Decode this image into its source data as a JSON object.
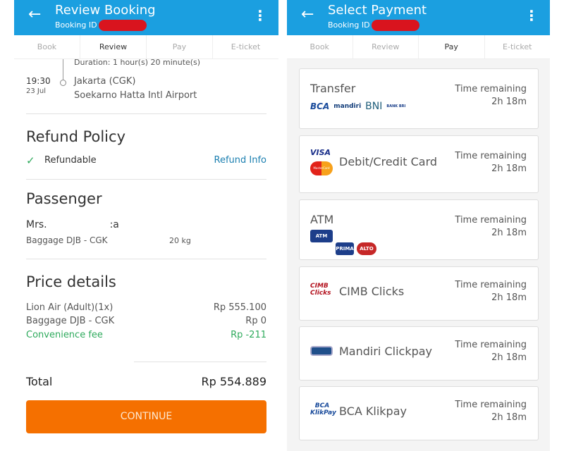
{
  "steps": [
    "Book",
    "Review",
    "Pay",
    "E-ticket"
  ],
  "review": {
    "title": "Review Booking",
    "booking_id_label": "Booking ID",
    "duration": "Duration: 1 hour(s) 20 minute(s)",
    "time": "19:30",
    "date": "23 Jul",
    "city": "Jakarta (CGK)",
    "airport": "Soekarno Hatta Intl Airport",
    "refund_heading": "Refund Policy",
    "refundable": "Refundable",
    "refund_info": "Refund Info",
    "passenger_heading": "Passenger",
    "passenger_name": "Mrs.                    :a",
    "baggage": "Baggage DJB - CGK",
    "baggage_weight": "20 kg",
    "price_heading": "Price details",
    "prices": [
      {
        "label": "Lion Air (Adult)(1x)",
        "value": "Rp 555.100"
      },
      {
        "label": "Baggage DJB - CGK",
        "value": "Rp 0"
      },
      {
        "label": "Convenience fee",
        "value": "Rp -211"
      }
    ],
    "total_label": "Total",
    "total_value": "Rp 554.889",
    "continue": "CONTINUE"
  },
  "payment": {
    "title": "Select Payment",
    "booking_id_label": "Booking ID",
    "time_label": "Time remaining",
    "time_value": "2h 18m",
    "methods": [
      "Transfer",
      "Debit/Credit Card",
      "ATM",
      "CIMB Clicks",
      "Mandiri Clickpay",
      "BCA Klikpay"
    ],
    "logos": {
      "bca": "BCA",
      "mandiri": "mandiri",
      "bni": "BNI",
      "bri": "BANK BRI",
      "visa": "VISA",
      "mastercard": "MasterCard",
      "atm_bersama": "ATM BERSAMA",
      "prima": "PRIMA",
      "alto": "ALTO",
      "cimb": "CIMB Clicks",
      "bca_klikpay": "BCA KlikPay"
    }
  },
  "colors": {
    "header": "#1b9fe0",
    "accent": "#f57000",
    "green": "#2eaa5c"
  }
}
